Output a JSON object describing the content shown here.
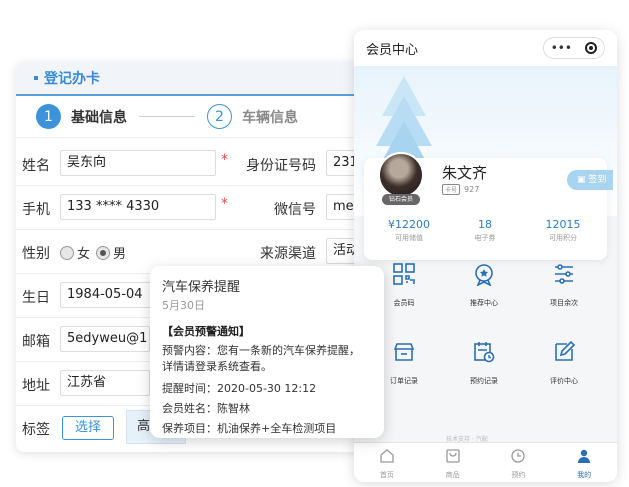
{
  "registration": {
    "title": "登记办卡",
    "steps": [
      {
        "num": "1",
        "label": "基础信息"
      },
      {
        "num": "2",
        "label": "车辆信息"
      }
    ],
    "fields": {
      "name_label": "姓名",
      "name_value": "吴东向",
      "id_label": "身份证号码",
      "id_value": "231",
      "phone_label": "手机",
      "phone_value": "133 **** 4330",
      "wechat_label": "微信号",
      "wechat_value": "mel",
      "gender_label": "性别",
      "gender_female": "女",
      "gender_male": "男",
      "source_label": "来源渠道",
      "source_value": "活动",
      "birthday_label": "生日",
      "birthday_value": "1984-05-04",
      "email_label": "邮箱",
      "email_value": "5edyweu@1",
      "address_label": "地址",
      "address_value": "江苏省",
      "tag_label": "标签",
      "tag_select": "选择",
      "tag_chip": "高"
    },
    "required_mark": "*"
  },
  "notification": {
    "title": "汽车保养提醒",
    "date": "5月30日",
    "heading": "【会员预警通知】",
    "lines": [
      "预警内容：您有一条新的汽车保养提醒，",
      "详情请登录系统查看。",
      "提醒时间：2020-05-30 12:12",
      "会员姓名：陈智林",
      "保养项目：机油保养+全车检测项目"
    ]
  },
  "phone": {
    "title": "会员中心",
    "capsule_dots": "•••",
    "member": {
      "name": "朱文齐",
      "card_badge": "卡号",
      "card_no": "927",
      "level": "钻石会员",
      "signin": "签到"
    },
    "stats": [
      {
        "value": "¥12200",
        "caption": "可用储值"
      },
      {
        "value": "18",
        "caption": "电子券"
      },
      {
        "value": "12015",
        "caption": "可用积分"
      }
    ],
    "grid": [
      {
        "label": "会员码",
        "icon": "qr-code-icon"
      },
      {
        "label": "推荐中心",
        "icon": "medal-icon"
      },
      {
        "label": "项目余次",
        "icon": "sliders-icon"
      },
      {
        "label": "订单记录",
        "icon": "store-icon"
      },
      {
        "label": "预约记录",
        "icon": "calendar-clock-icon"
      },
      {
        "label": "评价中心",
        "icon": "edit-icon"
      }
    ],
    "faint_text": "技术支持 · 汽配",
    "tabs": [
      {
        "label": "首页",
        "icon": "home-icon"
      },
      {
        "label": "商品",
        "icon": "bag-icon"
      },
      {
        "label": "预约",
        "icon": "clock-icon"
      },
      {
        "label": "我的",
        "icon": "user-icon"
      }
    ],
    "accent": "#2a7dc6"
  }
}
